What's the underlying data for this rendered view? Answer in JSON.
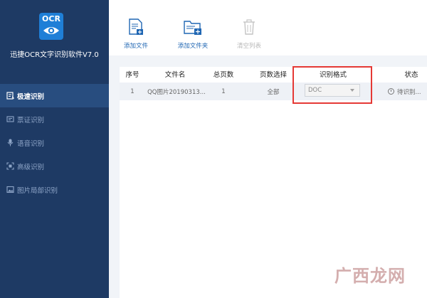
{
  "app": {
    "logo_text": "OCR",
    "title": "迅捷OCR文字识别软件V7.0"
  },
  "sidebar": {
    "items": [
      {
        "label": "极速识别",
        "active": true,
        "icon": "fast-recognition-icon"
      },
      {
        "label": "票证识别",
        "active": false,
        "icon": "ticket-recognition-icon"
      },
      {
        "label": "语音识别",
        "active": false,
        "icon": "microphone-icon"
      },
      {
        "label": "高级识别",
        "active": false,
        "icon": "scan-frame-icon"
      },
      {
        "label": "图片局部识别",
        "active": false,
        "icon": "image-crop-icon"
      }
    ]
  },
  "toolbar": {
    "add_file": "添加文件",
    "add_folder": "添加文件夹",
    "clear_list": "清空列表"
  },
  "table": {
    "headers": [
      "序号",
      "文件名",
      "总页数",
      "页数选择",
      "识别格式",
      "状态"
    ],
    "rows": [
      {
        "index": "1",
        "filename": "QQ图片20190313...",
        "pages": "1",
        "page_select": "全部",
        "format": "DOC",
        "status": "待识别..."
      }
    ]
  },
  "watermark": "广西龙网",
  "colors": {
    "sidebar_bg": "#1e3a64",
    "sidebar_active": "#284d7f",
    "accent_blue": "#1f66b3",
    "highlight_red": "#e53935"
  }
}
